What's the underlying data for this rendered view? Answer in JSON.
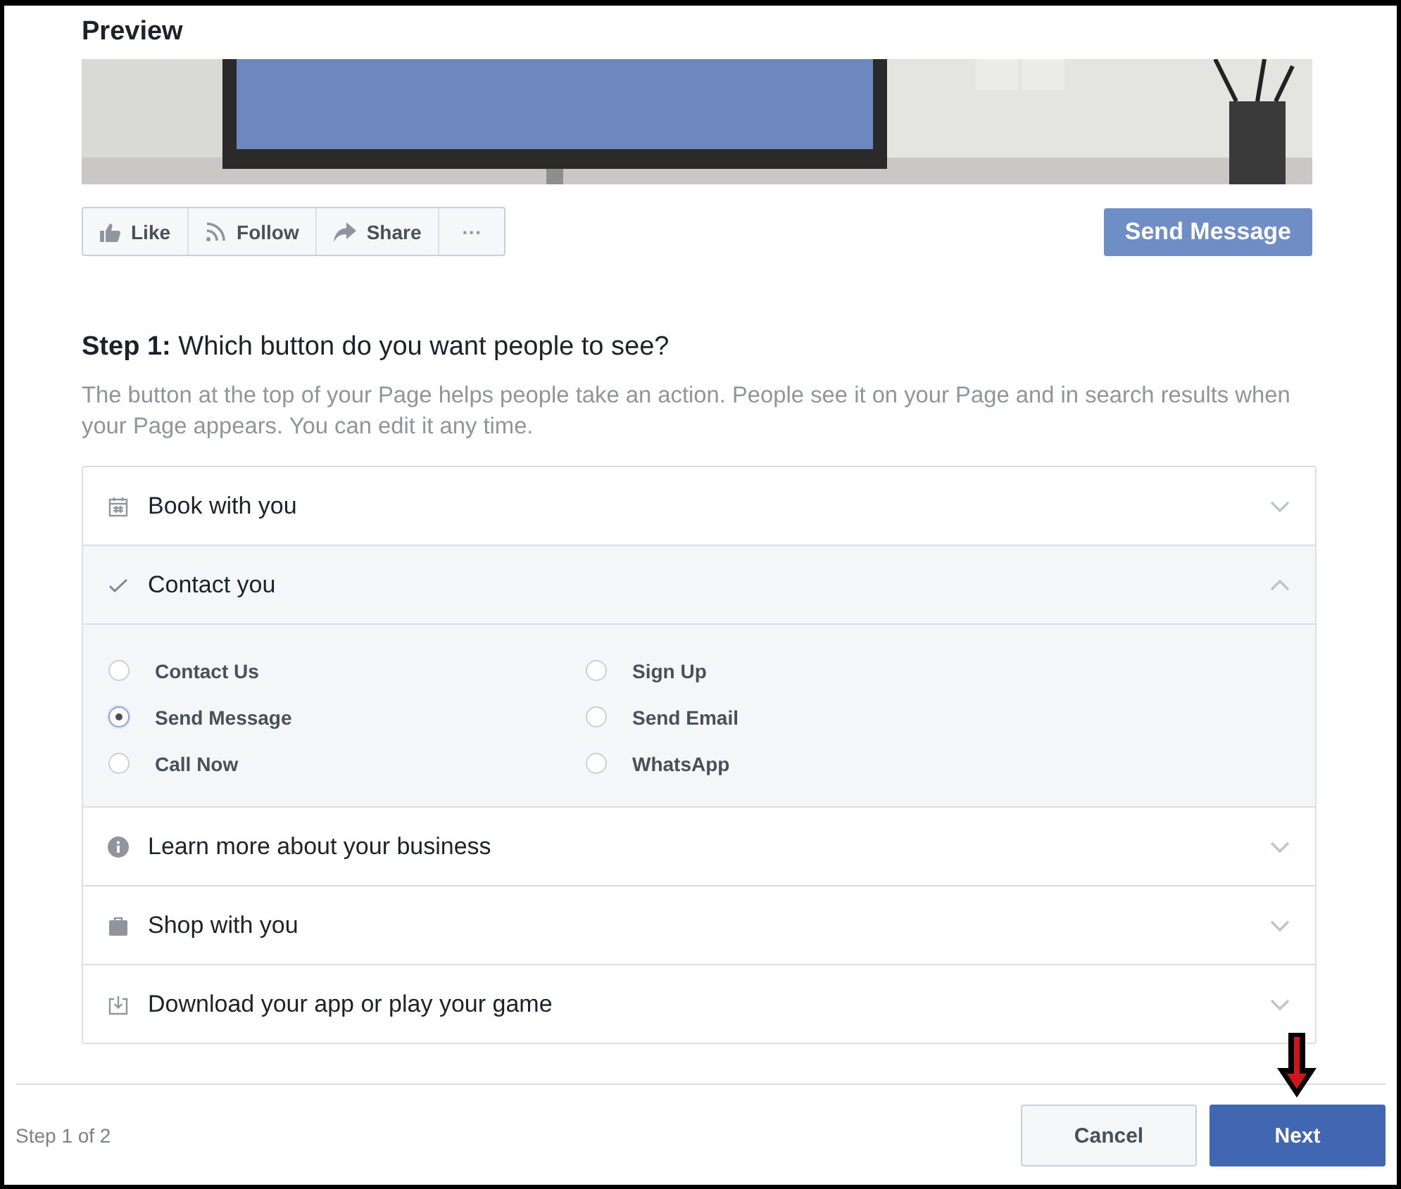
{
  "preview": {
    "title": "Preview",
    "actions": [
      "Like",
      "Follow",
      "Share",
      "···"
    ],
    "cta_button": "Send Message"
  },
  "step": {
    "label": "Step 1:",
    "question": "Which button do you want people to see?",
    "description": "The button at the top of your Page helps people take an action. People see it on your Page and in search results when your Page appears. You can edit it any time."
  },
  "options": [
    {
      "label": "Book with you",
      "selected": false,
      "expanded": false
    },
    {
      "label": "Contact you",
      "selected": true,
      "expanded": true,
      "choices": [
        {
          "label": "Contact Us",
          "selected": false
        },
        {
          "label": "Send Message",
          "selected": true
        },
        {
          "label": "Call Now",
          "selected": false
        },
        {
          "label": "Sign Up",
          "selected": false
        },
        {
          "label": "Send Email",
          "selected": false
        },
        {
          "label": "WhatsApp",
          "selected": false
        }
      ]
    },
    {
      "label": "Learn more about your business",
      "selected": false,
      "expanded": false
    },
    {
      "label": "Shop with you",
      "selected": false,
      "expanded": false
    },
    {
      "label": "Download your app or play your game",
      "selected": false,
      "expanded": false
    }
  ],
  "footer": {
    "progress": "Step 1 of 2",
    "buttons": [
      "Cancel",
      "Next"
    ]
  }
}
